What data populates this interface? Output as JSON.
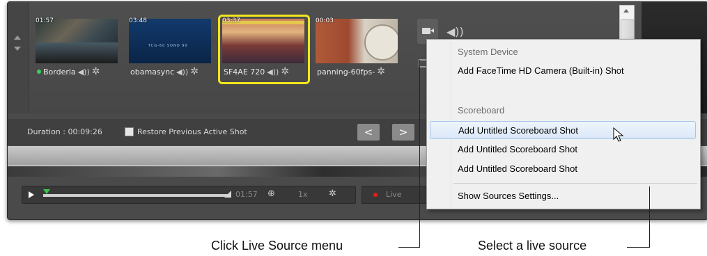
{
  "shots": [
    {
      "time": "01:57",
      "name": "Borderla",
      "live": true
    },
    {
      "time": "03:48",
      "name": "obamasync",
      "live": false,
      "thumb_text": "TCG-60 SONO 90"
    },
    {
      "time": "03:37",
      "name": "SF4AE  720",
      "live": false,
      "selected": true
    },
    {
      "time": "00:03",
      "name": "panning-60fps-",
      "live": false
    }
  ],
  "duration": {
    "label": "Duration : 00:09:26"
  },
  "restore": {
    "label": "Restore Previous Active Shot",
    "checked": false
  },
  "nav": {
    "prev": "<",
    "next": ">"
  },
  "timeline": {
    "time": "01:57",
    "speed": "1x"
  },
  "live_status": {
    "label": "Live"
  },
  "menu": {
    "header_system": "System Device",
    "item_facetime": "Add FaceTime HD Camera (Built-in) Shot",
    "header_scoreboard": "Scoreboard",
    "scoreboard_items": [
      "Add Untitled Scoreboard Shot",
      "Add Untitled Scoreboard Shot",
      "Add Untitled Scoreboard Shot"
    ],
    "show_settings": "Show Sources Settings..."
  },
  "callouts": {
    "left": "Click Live Source menu",
    "right": "Select a live source"
  },
  "colors": {
    "selection": "#f2e51c",
    "live_green": "#38d45a",
    "live_red": "#e0201a"
  },
  "icons": {
    "device": "camera-icon",
    "audio": "speaker-icon",
    "settings": "gear-icon",
    "volume": "volume-icon"
  }
}
